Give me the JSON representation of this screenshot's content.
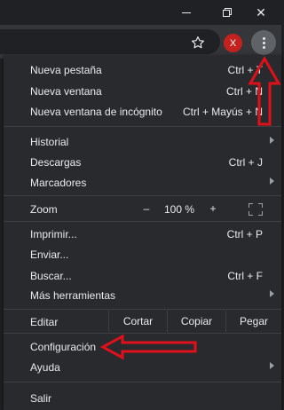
{
  "window": {
    "minimize_icon": "minimize-icon",
    "restore_icon": "restore-icon",
    "close_glyph": "✕"
  },
  "toolbar": {
    "profile_initial": "X",
    "star_icon": "star-outline-icon",
    "menu_icon": "three-dots-vertical-icon"
  },
  "menu": {
    "new_tab": {
      "label": "Nueva pestaña",
      "shortcut": "Ctrl + T"
    },
    "new_window": {
      "label": "Nueva ventana",
      "shortcut": "Ctrl + N"
    },
    "incognito": {
      "label": "Nueva ventana de incógnito",
      "shortcut": "Ctrl + Mayús + N"
    },
    "history": {
      "label": "Historial"
    },
    "downloads": {
      "label": "Descargas",
      "shortcut": "Ctrl + J"
    },
    "bookmarks": {
      "label": "Marcadores"
    },
    "zoom": {
      "label": "Zoom",
      "minus": "–",
      "value": "100 %",
      "plus": "+"
    },
    "print": {
      "label": "Imprimir...",
      "shortcut": "Ctrl + P"
    },
    "cast": {
      "label": "Enviar..."
    },
    "find": {
      "label": "Buscar...",
      "shortcut": "Ctrl + F"
    },
    "more_tools": {
      "label": "Más herramientas"
    },
    "edit": {
      "label": "Editar",
      "cut": "Cortar",
      "copy": "Copiar",
      "paste": "Pegar"
    },
    "settings": {
      "label": "Configuración"
    },
    "help": {
      "label": "Ayuda"
    },
    "exit": {
      "label": "Salir"
    }
  },
  "colors": {
    "annotation_arrow": "#e0101a",
    "menu_bg": "#292a2d",
    "text": "#e8eaed"
  }
}
